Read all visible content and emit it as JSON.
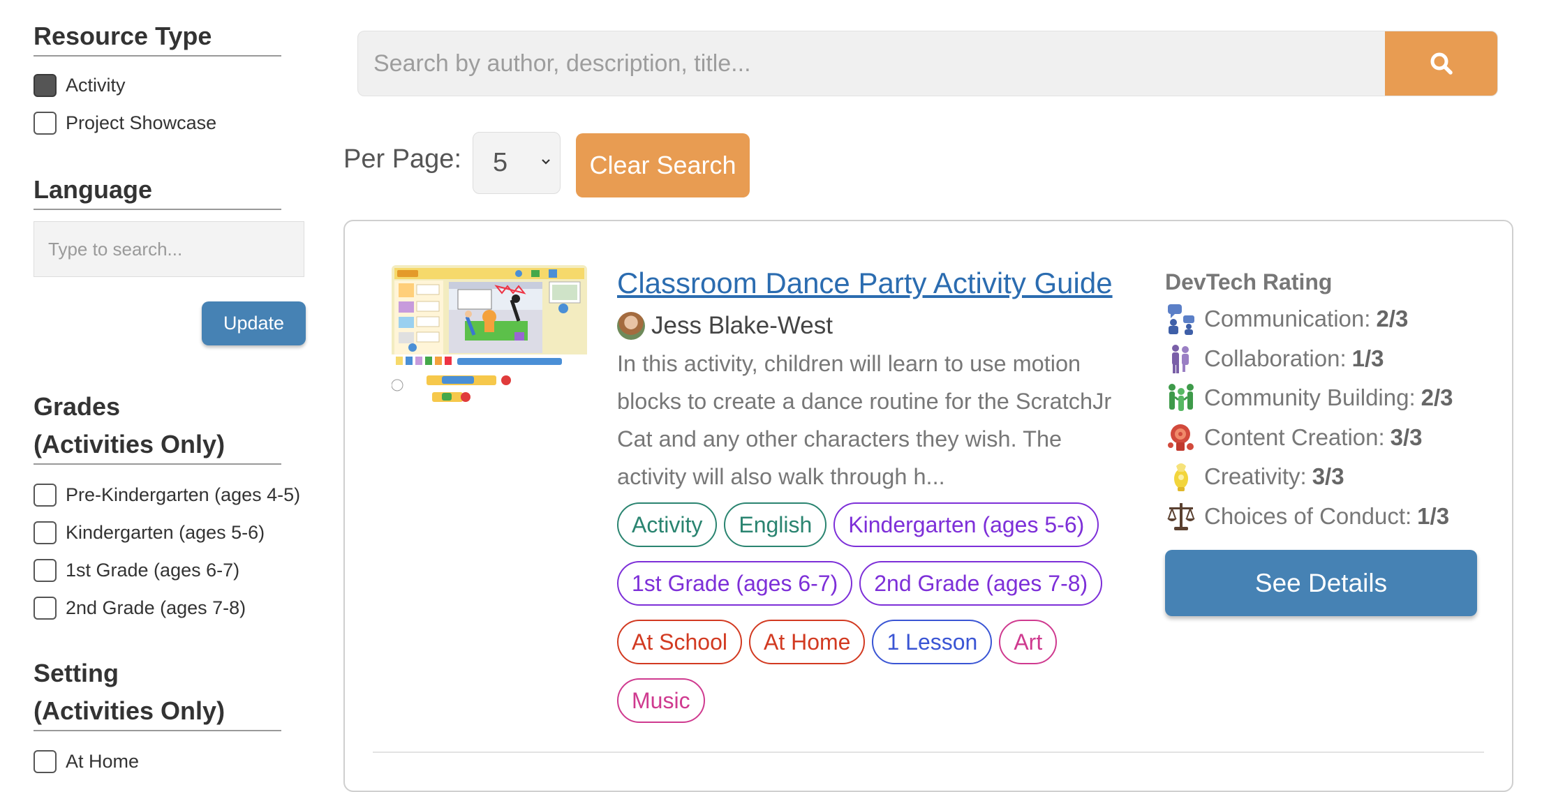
{
  "sidebar": {
    "resource_type": {
      "title": "Resource Type",
      "options": [
        {
          "label": "Activity",
          "checked": true
        },
        {
          "label": "Project Showcase",
          "checked": false
        }
      ]
    },
    "language": {
      "title": "Language",
      "placeholder": "Type to search...",
      "update_label": "Update"
    },
    "grades": {
      "title_line1": "Grades",
      "title_line2": "(Activities Only)",
      "options": [
        {
          "label": "Pre-Kindergarten (ages 4-5)",
          "checked": false
        },
        {
          "label": "Kindergarten (ages 5-6)",
          "checked": false
        },
        {
          "label": "1st Grade (ages 6-7)",
          "checked": false
        },
        {
          "label": "2nd Grade (ages 7-8)",
          "checked": false
        }
      ]
    },
    "setting": {
      "title_line1": "Setting",
      "title_line2": "(Activities Only)",
      "options": [
        {
          "label": "At Home",
          "checked": false
        }
      ]
    }
  },
  "search": {
    "placeholder": "Search by author, description, title...",
    "button_icon": "search-icon",
    "accent_color": "#e89c52"
  },
  "controls": {
    "per_page_label": "Per Page:",
    "per_page_value": "5",
    "clear_label": "Clear Search"
  },
  "result": {
    "title": "Classroom Dance Party Activity Guide",
    "author": "Jess Blake-West",
    "description": "In this activity, children will learn to use motion blocks to create a dance routine for the ScratchJr Cat and any other characters they wish. The activity will also walk through h...",
    "tags": [
      {
        "label": "Activity",
        "color": "#2a8470"
      },
      {
        "label": "English",
        "color": "#2a8470"
      },
      {
        "label": "Kindergarten (ages 5-6)",
        "color": "#7d2fd8"
      },
      {
        "label": "1st Grade (ages 6-7)",
        "color": "#7d2fd8"
      },
      {
        "label": "2nd Grade (ages 7-8)",
        "color": "#7d2fd8"
      },
      {
        "label": "At School",
        "color": "#d23a21"
      },
      {
        "label": "At Home",
        "color": "#d23a21"
      },
      {
        "label": "1 Lesson",
        "color": "#3a55d4"
      },
      {
        "label": "Art",
        "color": "#cf3a8f"
      },
      {
        "label": "Music",
        "color": "#cf3a8f"
      }
    ],
    "rating": {
      "title": "DevTech Rating",
      "items": [
        {
          "label": "Communication:",
          "value": "2/3",
          "icon": "communication-icon"
        },
        {
          "label": "Collaboration:",
          "value": "1/3",
          "icon": "collaboration-icon"
        },
        {
          "label": "Community Building:",
          "value": "2/3",
          "icon": "community-building-icon"
        },
        {
          "label": "Content Creation:",
          "value": "3/3",
          "icon": "content-creation-icon"
        },
        {
          "label": "Creativity:",
          "value": "3/3",
          "icon": "creativity-icon"
        },
        {
          "label": "Choices of Conduct:",
          "value": "1/3",
          "icon": "choices-of-conduct-icon"
        }
      ]
    },
    "details_label": "See Details"
  },
  "colors": {
    "primary_blue": "#4682b4",
    "accent_orange": "#e89c52",
    "link_blue": "#2b6cb0"
  }
}
